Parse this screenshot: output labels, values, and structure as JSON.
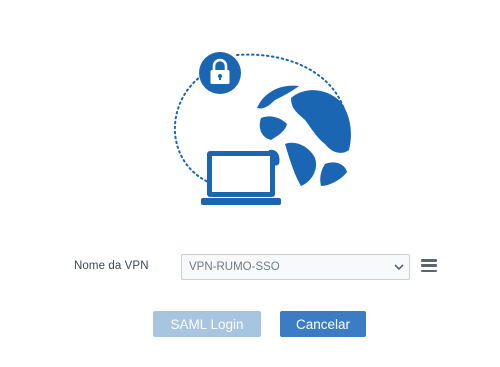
{
  "vpn": {
    "label": "Nome da VPN",
    "selected": "VPN-RUMO-SSO"
  },
  "buttons": {
    "saml_login": "SAML Login",
    "cancel": "Cancelar"
  },
  "icons": [
    "vpn-illustration",
    "lock-icon",
    "globe-icon",
    "laptop-icon",
    "chevron-down-icon",
    "menu-icon"
  ],
  "colors": {
    "brand_blue": "#1a66b3",
    "cancel_button": "#3b7cc4",
    "saml_button_disabled": "#a7c4e0",
    "label_text": "#3c4853"
  }
}
